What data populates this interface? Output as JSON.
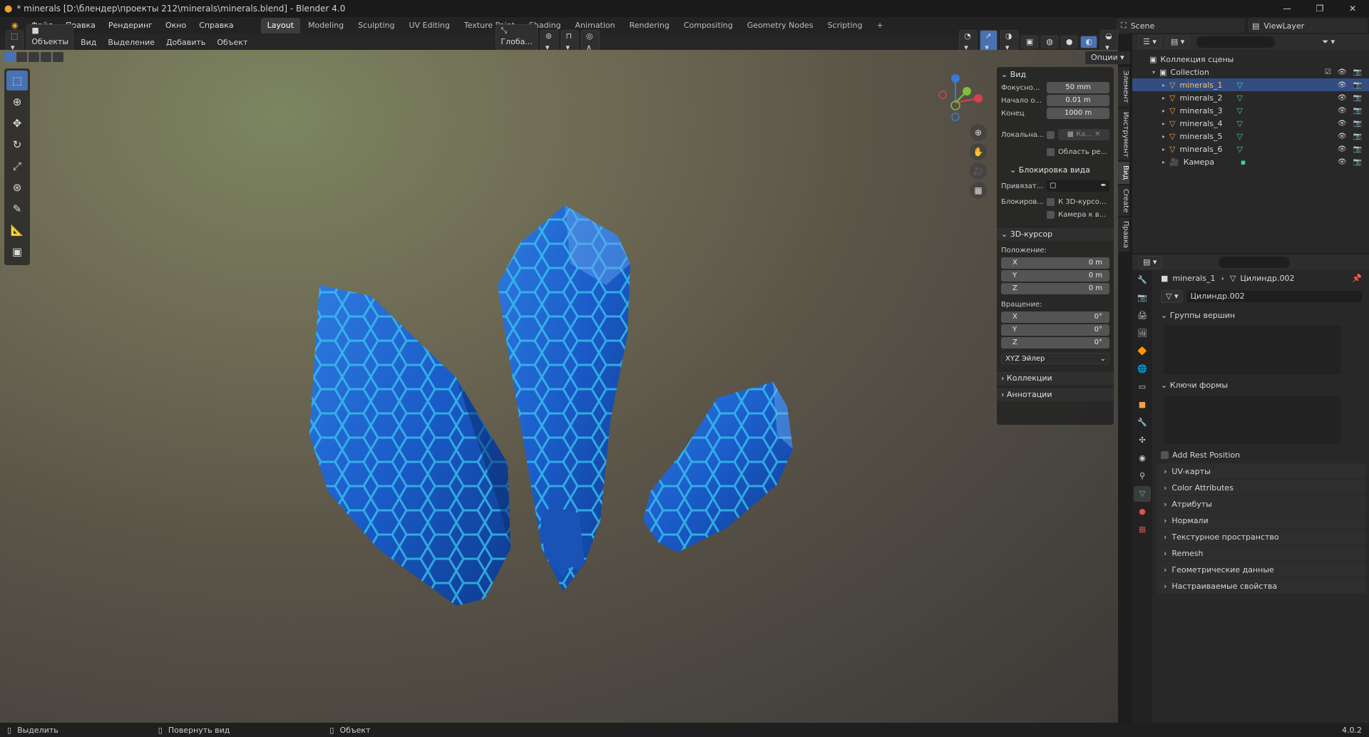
{
  "window": {
    "title": "* minerals [D:\\блендер\\проекты 212\\minerals\\minerals.blend] - Blender 4.0"
  },
  "menu": [
    "Файл",
    "Правка",
    "Рендеринг",
    "Окно",
    "Справка"
  ],
  "workspaces": [
    "Layout",
    "Modeling",
    "Sculpting",
    "UV Editing",
    "Texture Paint",
    "Shading",
    "Animation",
    "Rendering",
    "Compositing",
    "Geometry Nodes",
    "Scripting",
    "+"
  ],
  "scene": "Scene",
  "viewlayer": "ViewLayer",
  "vp": {
    "mode": "Объекты",
    "menus": [
      "Вид",
      "Выделение",
      "Добавить",
      "Объект"
    ],
    "transform": "Глоба...",
    "options": "Опции"
  },
  "npanel": {
    "view_title": "Вид",
    "focal": {
      "label": "Фокусно...",
      "value": "50 mm"
    },
    "clip_start": {
      "label": "Начало о...",
      "value": "0.01 m"
    },
    "clip_end": {
      "label": "Конец",
      "value": "1000 m"
    },
    "local": {
      "label": "Локальна...",
      "value": "Ка..."
    },
    "region": "Область ре...",
    "lock_title": "Блокировка вида",
    "lock_to": {
      "label": "Привязат..."
    },
    "lock": {
      "label": "Блокиров...",
      "opt1": "К 3D-курсо...",
      "opt2": "Камера к в..."
    },
    "cursor_title": "3D-курсор",
    "location": "Положение:",
    "loc": [
      {
        "a": "X",
        "v": "0 m"
      },
      {
        "a": "Y",
        "v": "0 m"
      },
      {
        "a": "Z",
        "v": "0 m"
      }
    ],
    "rotation": "Вращение:",
    "rot": [
      {
        "a": "X",
        "v": "0°"
      },
      {
        "a": "Y",
        "v": "0°"
      },
      {
        "a": "Z",
        "v": "0°"
      }
    ],
    "rotmode": "XYZ Эйлер",
    "collections": "Коллекции",
    "annotations": "Аннотации"
  },
  "vtabs": [
    "Элемент",
    "Инструмент",
    "Вид",
    "Create",
    "Правка"
  ],
  "outliner": {
    "root": "Коллекция сцены",
    "collection": "Collection",
    "items": [
      "minerals_1",
      "minerals_2",
      "minerals_3",
      "minerals_4",
      "minerals_5",
      "minerals_6"
    ],
    "camera": "Камера"
  },
  "props": {
    "crumb_obj": "minerals_1",
    "crumb_mesh": "Цилиндр.002",
    "mesh_name": "Цилиндр.002",
    "vgroups": "Группы вершин",
    "shapekeys": "Ключи формы",
    "rest": "Add Rest Position",
    "sections": [
      "UV-карты",
      "Color Attributes",
      "Атрибуты",
      "Нормали",
      "Текстурное пространство",
      "Remesh",
      "Геометрические данные",
      "Настраиваемые свойства"
    ]
  },
  "status": {
    "select": "Выделить",
    "rotate": "Повернуть вид",
    "object": "Объект",
    "version": "4.0.2"
  }
}
